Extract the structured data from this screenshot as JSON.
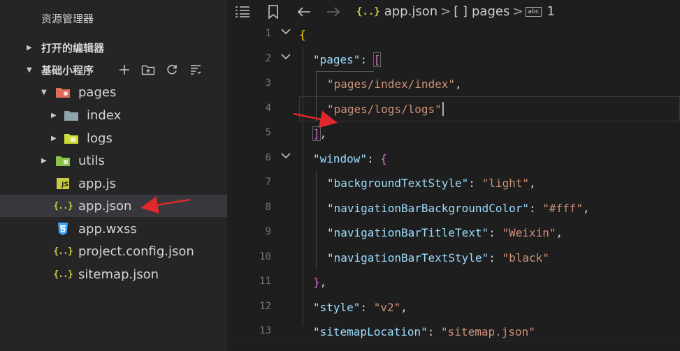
{
  "sidebar": {
    "title": "资源管理器",
    "open_editors": "打开的编辑器",
    "project": "基础小程序",
    "tree": [
      {
        "name": "pages"
      },
      {
        "name": "index"
      },
      {
        "name": "logs"
      },
      {
        "name": "utils"
      },
      {
        "name": "app.js",
        "badge": "JS"
      },
      {
        "name": "app.json",
        "badge": "{..}"
      },
      {
        "name": "app.wxss"
      },
      {
        "name": "project.config.json",
        "badge": "{..}"
      },
      {
        "name": "sitemap.json",
        "badge": "{..}"
      }
    ]
  },
  "breadcrumb": {
    "file_icon": "{..}",
    "file": "app.json",
    "sep1": ">",
    "array_icon": "[ ]",
    "key": "pages",
    "sep2": ">",
    "index_badge": "abc",
    "index": "1"
  },
  "code": {
    "line_numbers": [
      "1",
      "2",
      "3",
      "4",
      "5",
      "6",
      "7",
      "8",
      "9",
      "10",
      "11",
      "12",
      "13"
    ],
    "l1_brace": "{",
    "l2_key": "\"pages\"",
    "l2_colon": ": ",
    "l2_bracket": "[",
    "l3_str": "\"pages/index/index\"",
    "l3_comma": ",",
    "l4_str": "\"pages/logs/logs\"",
    "l5_bracket": "]",
    "l5_comma": ",",
    "l6_key": "\"window\"",
    "l6_colon": ": ",
    "l6_brace": "{",
    "l7_key": "\"backgroundTextStyle\"",
    "l7_colon": ": ",
    "l7_val": "\"light\"",
    "l7_comma": ",",
    "l8_key": "\"navigationBarBackgroundColor\"",
    "l8_colon": ": ",
    "l8_val": "\"#fff\"",
    "l8_comma": ",",
    "l9_key": "\"navigationBarTitleText\"",
    "l9_colon": ": ",
    "l9_val": "\"Weixin\"",
    "l9_comma": ",",
    "l10_key": "\"navigationBarTextStyle\"",
    "l10_colon": ": ",
    "l10_val": "\"black\"",
    "l11_brace": "}",
    "l11_comma": ",",
    "l12_key": "\"style\"",
    "l12_colon": ": ",
    "l12_val": "\"v2\"",
    "l12_comma": ",",
    "l13_key": "\"sitemapLocation\"",
    "l13_colon": ": ",
    "l13_val": "\"sitemap.json\""
  },
  "colors": {
    "annotation_arrow": "#e0282c",
    "json_badge": "#cbcb41",
    "folder_pages": "#e06c5a",
    "folder_utils": "#8bc34a",
    "css_icon": "#42a5f5"
  }
}
